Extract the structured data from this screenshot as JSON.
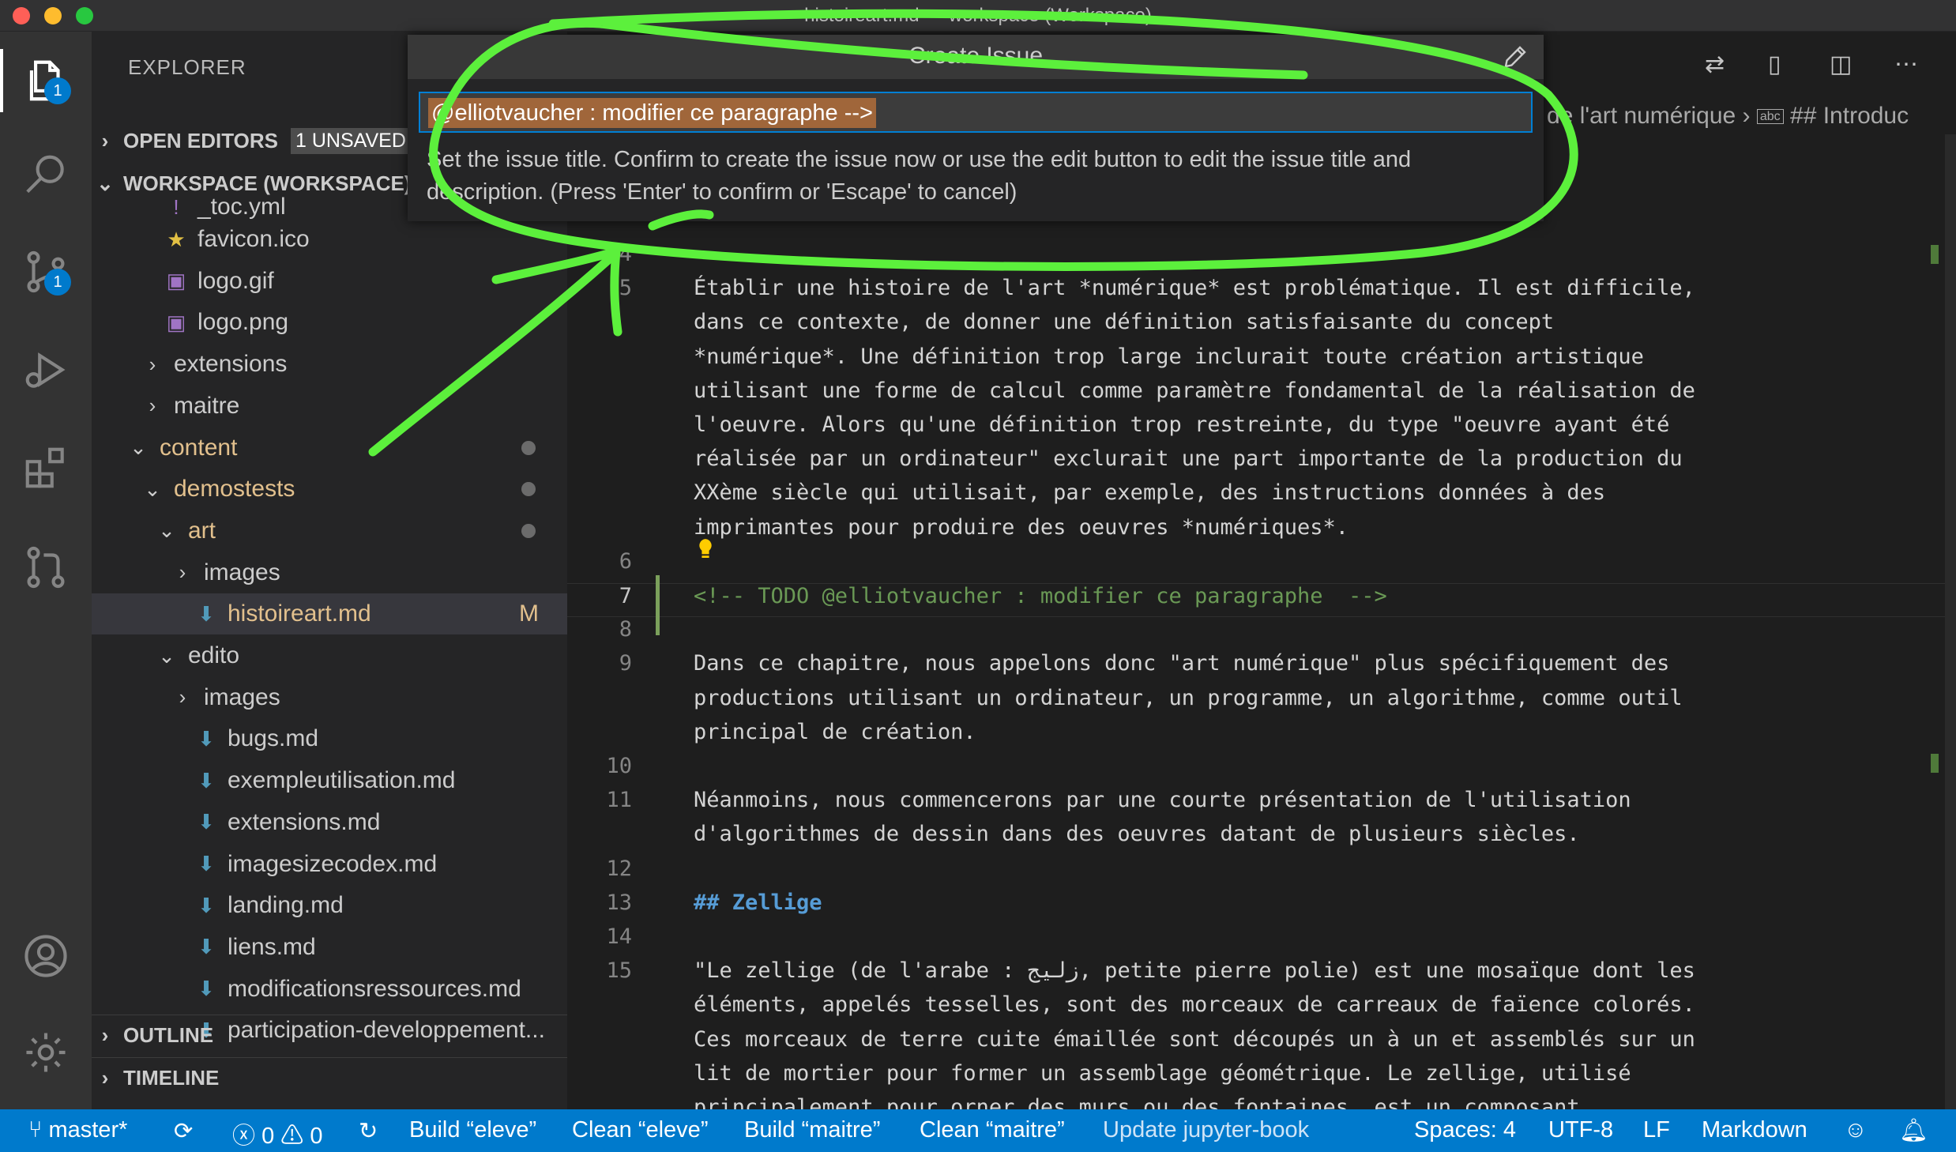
{
  "window": {
    "title": "histoireart.md — workspace (Workspace)"
  },
  "activity_bar": {
    "explorer_badge": "1",
    "scm_badge": "1"
  },
  "sidebar": {
    "title": "EXPLORER",
    "open_editors": {
      "label": "OPEN EDITORS",
      "badge": "1 UNSAVED"
    },
    "workspace": {
      "label": "WORKSPACE (WORKSPACE)"
    },
    "tree": [
      {
        "label": "_toc.yml",
        "kind": "yml",
        "depth": 1
      },
      {
        "label": "favicon.ico",
        "kind": "star",
        "depth": 1
      },
      {
        "label": "logo.gif",
        "kind": "image",
        "depth": 1
      },
      {
        "label": "logo.png",
        "kind": "image",
        "depth": 1
      },
      {
        "label": "extensions",
        "kind": "folder-closed",
        "depth": 1
      },
      {
        "label": "maitre",
        "kind": "folder-closed",
        "depth": 1
      },
      {
        "label": "content",
        "kind": "folder-open",
        "depth": 0,
        "modified": true
      },
      {
        "label": "demostests",
        "kind": "folder-open",
        "depth": 1,
        "modified": true
      },
      {
        "label": "art",
        "kind": "folder-open",
        "depth": 2,
        "modified": true
      },
      {
        "label": "images",
        "kind": "folder-closed",
        "depth": 3
      },
      {
        "label": "histoireart.md",
        "kind": "markdown",
        "depth": 3,
        "status": "M",
        "active": true
      },
      {
        "label": "edito",
        "kind": "folder-open",
        "depth": 2
      },
      {
        "label": "images",
        "kind": "folder-closed",
        "depth": 3
      },
      {
        "label": "bugs.md",
        "kind": "markdown",
        "depth": 3
      },
      {
        "label": "exempleutilisation.md",
        "kind": "markdown",
        "depth": 3
      },
      {
        "label": "extensions.md",
        "kind": "markdown",
        "depth": 3
      },
      {
        "label": "imagesizecodex.md",
        "kind": "markdown",
        "depth": 3
      },
      {
        "label": "landing.md",
        "kind": "markdown",
        "depth": 3
      },
      {
        "label": "liens.md",
        "kind": "markdown",
        "depth": 3
      },
      {
        "label": "modificationsressources.md",
        "kind": "markdown",
        "depth": 3
      },
      {
        "label": "participation-developpement...",
        "kind": "markdown",
        "depth": 3
      }
    ],
    "outline": "OUTLINE",
    "timeline": "TIMELINE"
  },
  "breadcrumb": {
    "part1": "de l'art numérique",
    "part2": "## Introduc"
  },
  "quick_pick": {
    "title": "Create Issue",
    "input_value": "@elliotvaucher : modifier ce paragraphe  -->",
    "message": "Set the issue title. Confirm to create the issue now or use the edit button to edit the issue title and description. (Press 'Enter' to confirm or 'Escape' to cancel)"
  },
  "editor": {
    "lines": [
      {
        "n": "4",
        "text": "",
        "kind": "text"
      },
      {
        "n": "5",
        "text": "Établir une histoire de l'art *numérique* est problématique. Il est difficile,",
        "kind": "text"
      },
      {
        "n": "",
        "text": "dans ce contexte, de donner une définition satisfaisante du concept",
        "kind": "text"
      },
      {
        "n": "",
        "text": "*numérique*. Une définition trop large inclurait toute création artistique",
        "kind": "text"
      },
      {
        "n": "",
        "text": "utilisant une forme de calcul comme paramètre fondamental de la réalisation de",
        "kind": "text"
      },
      {
        "n": "",
        "text": "l'oeuvre. Alors qu'une définition trop restreinte, du type \"oeuvre ayant été",
        "kind": "text"
      },
      {
        "n": "",
        "text": "réalisée par un ordinateur\" exclurait une part importante de la production du",
        "kind": "text"
      },
      {
        "n": "",
        "text": "XXème siècle qui utilisait, par exemple, des instructions données à des",
        "kind": "text"
      },
      {
        "n": "",
        "text": "imprimantes pour produire des oeuvres *numériques*.",
        "kind": "text"
      },
      {
        "n": "6",
        "text": "",
        "kind": "text"
      },
      {
        "n": "7",
        "text": "<!-- TODO @elliotvaucher : modifier ce paragraphe  -->",
        "kind": "comment"
      },
      {
        "n": "8",
        "text": "",
        "kind": "text"
      },
      {
        "n": "9",
        "text": "Dans ce chapitre, nous appelons donc \"art numérique\" plus spécifiquement des",
        "kind": "text"
      },
      {
        "n": "",
        "text": "productions utilisant un ordinateur, un programme, un algorithme, comme outil",
        "kind": "text"
      },
      {
        "n": "",
        "text": "principal de création.",
        "kind": "text"
      },
      {
        "n": "10",
        "text": "",
        "kind": "text"
      },
      {
        "n": "11",
        "text": "Néanmoins, nous commencerons par une courte présentation de l'utilisation",
        "kind": "text"
      },
      {
        "n": "",
        "text": "d'algorithmes de dessin dans des oeuvres datant de plusieurs siècles.",
        "kind": "text"
      },
      {
        "n": "12",
        "text": "",
        "kind": "text"
      },
      {
        "n": "13",
        "text": "## Zellige",
        "kind": "heading"
      },
      {
        "n": "14",
        "text": "",
        "kind": "text"
      },
      {
        "n": "15",
        "text": "\"Le zellige (de l'arabe : زليج, petite pierre polie) est une mosaïque dont les",
        "kind": "text"
      },
      {
        "n": "",
        "text": "éléments, appelés tesselles, sont des morceaux de carreaux de faïence colorés.",
        "kind": "text"
      },
      {
        "n": "",
        "text": "Ces morceaux de terre cuite émaillée sont découpés un à un et assemblés sur un",
        "kind": "text"
      },
      {
        "n": "",
        "text": "lit de mortier pour former un assemblage géométrique. Le zellige, utilisé",
        "kind": "text"
      },
      {
        "n": "",
        "text": "principalement pour orner des murs ou des fontaines, est un composant",
        "kind": "text"
      }
    ]
  },
  "status_bar": {
    "branch": "master*",
    "errors": "0",
    "warnings": "0",
    "task1": "Build “eleve”",
    "task2": "Clean “eleve”",
    "task3": "Build “maitre”",
    "task4": "Clean “maitre”",
    "task5": "Update jupyter-book",
    "spaces": "Spaces: 4",
    "encoding": "UTF-8",
    "eol": "LF",
    "language": "Markdown"
  },
  "colors": {
    "accent": "#007acc",
    "annotation": "#5cf03c",
    "selection": "#a0663a"
  }
}
